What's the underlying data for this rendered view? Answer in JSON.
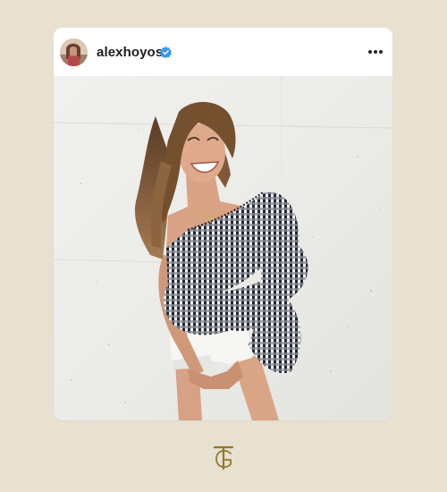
{
  "post": {
    "username": "alexhoyos",
    "verified": true,
    "icons": {
      "verified": "verified-badge-icon",
      "more": "more-options-icon"
    }
  },
  "colors": {
    "background": "#e8e1d1",
    "verified_badge": "#3897f0",
    "logo_gold": "#8f7a2e"
  },
  "footer": {
    "logo_icon": "tg-monogram-logo",
    "logo_text": "TG"
  }
}
